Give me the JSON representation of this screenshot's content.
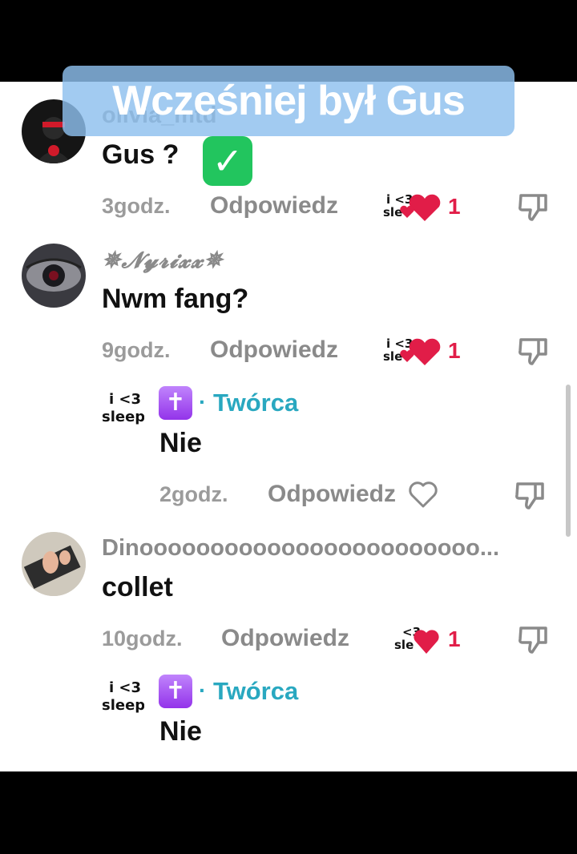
{
  "overlay": {
    "caption": "Wcześniej był Gus"
  },
  "comments": [
    {
      "username": "olivia_mtd",
      "text": "Gus ?",
      "emoji": "✓",
      "time": "3godz.",
      "reply_label": "Odpowiedz",
      "likes": "1",
      "liked_by_creator": true
    },
    {
      "username": "✵𝓝𝔂𝓻𝓲𝔁𝔁✵",
      "text": "Nwm fang?",
      "time": "9godz.",
      "reply_label": "Odpowiedz",
      "likes": "1",
      "liked_by_creator": true,
      "replies": [
        {
          "badge": "✝",
          "role": "Twórca",
          "text": "Nie",
          "time": "2godz.",
          "reply_label": "Odpowiedz",
          "liked": false
        }
      ]
    },
    {
      "username": "Dinoooooooooooooooooooooooo...",
      "text": "collet",
      "time": "10godz.",
      "reply_label": "Odpowiedz",
      "likes": "1",
      "liked_by_creator": true,
      "replies": [
        {
          "badge": "✝",
          "role": "Twórca",
          "text": "Nie"
        }
      ]
    }
  ],
  "creator_avatar_text": {
    "line1": "i <3",
    "line2": "sleep"
  },
  "colors": {
    "like": "#e11d48",
    "creator": "#29a8c0",
    "overlay": "#8ec0ee",
    "badge": "#9333ea"
  }
}
